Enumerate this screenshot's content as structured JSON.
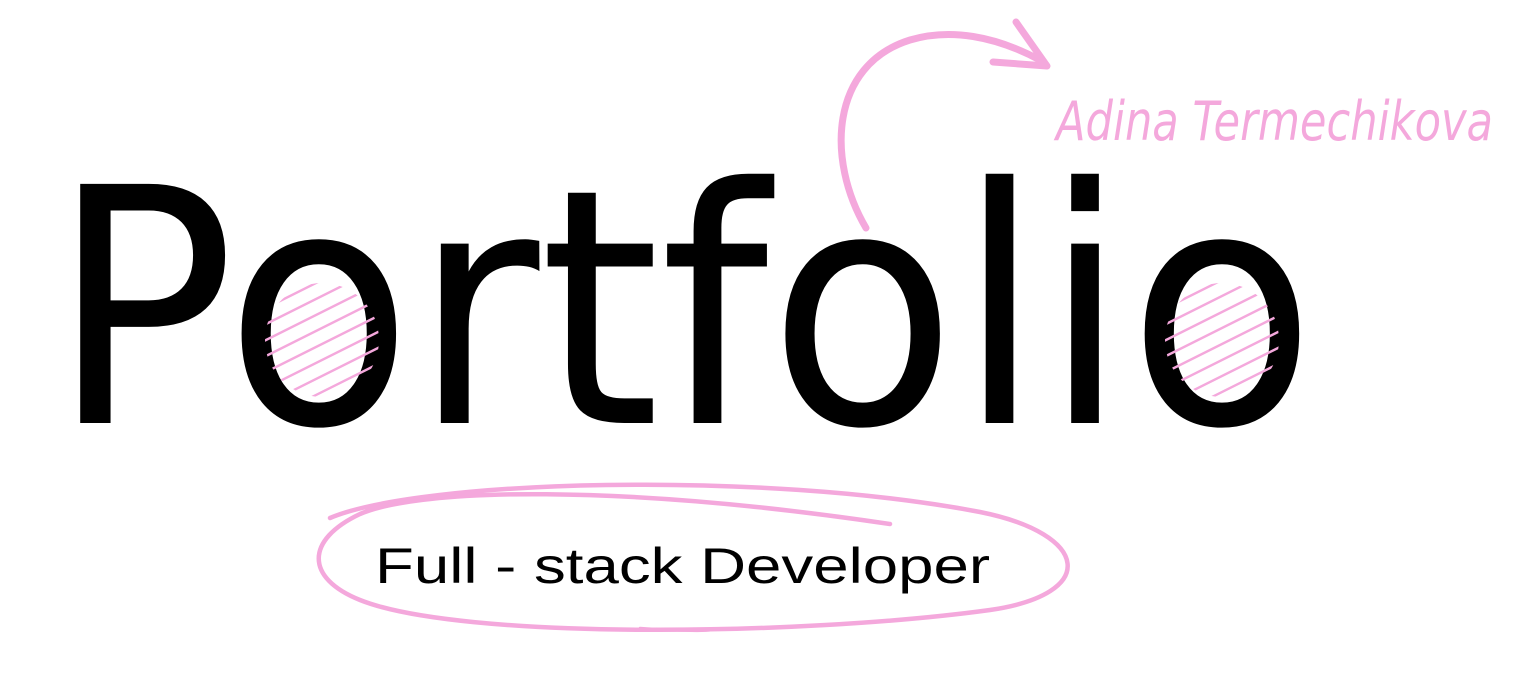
{
  "name": "Adina Termechikova",
  "title": "Portfolio",
  "subtitle": "Full - stack Developer",
  "colors": {
    "accent": "#f4a8dc",
    "text": "#000000",
    "background": "#ffffff"
  }
}
